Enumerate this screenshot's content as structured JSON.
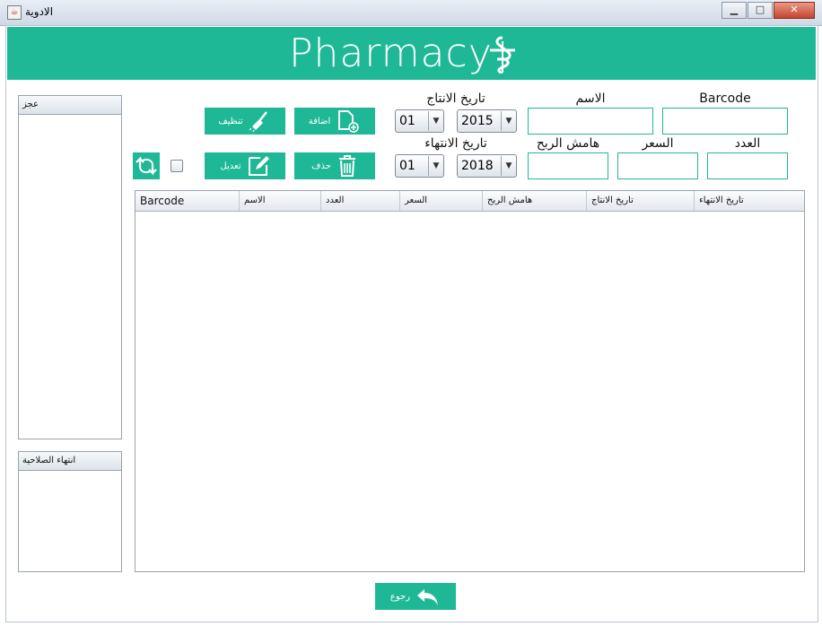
{
  "window": {
    "title": "الادوية",
    "minimize": "▁",
    "maximize": "□",
    "close": "✕"
  },
  "header": {
    "title": "Pharmacy",
    "logo_icon": "caduceus-icon"
  },
  "panels": {
    "shortage_label": "عجز",
    "expiry_label": "انتهاء الصلاحية"
  },
  "form": {
    "barcode_label": "Barcode",
    "name_label": "الاسم",
    "production_date_label": "تاريخ الانتاج",
    "quantity_label": "العدد",
    "price_label": "السعر",
    "profit_margin_label": "هامش الربح",
    "expiry_date_label": "تاريخ الانتهاء",
    "barcode_value": "",
    "name_value": "",
    "quantity_value": "",
    "price_value": "",
    "profit_margin_value": "",
    "prod_year": "2015",
    "prod_month": "01",
    "exp_year": "2018",
    "exp_month": "01"
  },
  "buttons": {
    "add": "اضافة",
    "clear": "تنظيف",
    "delete": "حذف",
    "edit": "تعديل",
    "back": "رجوع"
  },
  "table": {
    "columns": [
      "Barcode",
      "الاسم",
      "العدد",
      "السعر",
      "هامش الربح",
      "تاريخ الانتاج",
      "تاريخ الانتهاء"
    ]
  },
  "colors": {
    "accent": "#1fb896"
  }
}
